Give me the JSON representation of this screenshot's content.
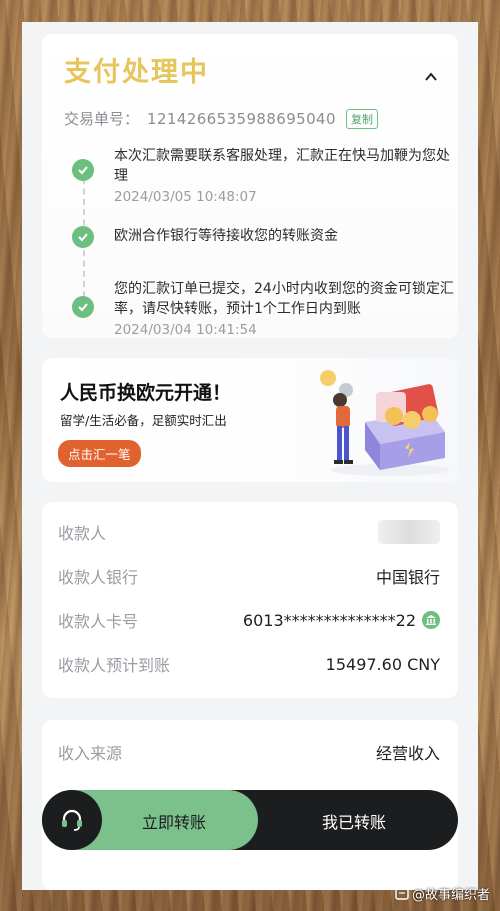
{
  "status": {
    "title": "支付处理中",
    "txn_label": "交易单号：",
    "txn_number": "1214266535988695040",
    "copy_label": "复制"
  },
  "timeline": [
    {
      "text": "本次汇款需要联系客服处理，汇款正在快马加鞭为您处理",
      "time": "2024/03/05 10:48:07"
    },
    {
      "text": "欧洲合作银行等待接收您的转账资金",
      "time": ""
    },
    {
      "text": "您的汇款订单已提交，24小时内收到您的资金可锁定汇率，请尽快转账，预计1个工作日内到账",
      "time": "2024/03/04 10:41:54"
    }
  ],
  "promo": {
    "title": "人民币换欧元开通！",
    "subtitle": "留学/生活必备，足额实时汇出",
    "button": "点击汇一笔"
  },
  "payee": {
    "name_label": "收款人",
    "bank_label": "收款人银行",
    "bank_value": "中国银行",
    "card_label": "收款人卡号",
    "card_value": "6013**************22",
    "arrival_label": "收款人预计到账",
    "arrival_value": "15497.60 CNY"
  },
  "source": {
    "label": "收入来源",
    "value": "经营收入"
  },
  "bottom": {
    "transfer_now": "立即转账",
    "transferred": "我已转账"
  },
  "watermark": "@故事编织者",
  "colors": {
    "title_gold": "#e6c65a",
    "accent_green": "#6cbf7f",
    "promo_orange": "#e0622e",
    "bar_dark": "#1c1d1f"
  }
}
